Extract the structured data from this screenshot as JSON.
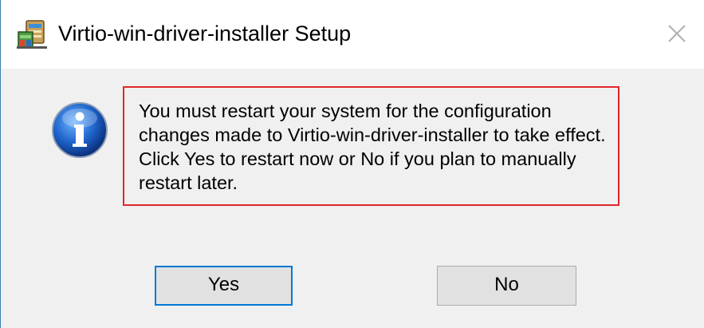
{
  "window": {
    "title": "Virtio-win-driver-installer Setup"
  },
  "message": {
    "text": "You must restart your system for the configuration changes made to Virtio-win-driver-installer to take effect. Click Yes to restart now or No if you plan to manually restart later."
  },
  "buttons": {
    "yes_label": "Yes",
    "no_label": "No"
  },
  "icons": {
    "app": "installer-icon",
    "info": "information-icon",
    "close": "close-icon"
  },
  "colors": {
    "highlight_border": "#e0262a",
    "default_button_border": "#0078d7",
    "window_border": "#3c7fb1"
  }
}
